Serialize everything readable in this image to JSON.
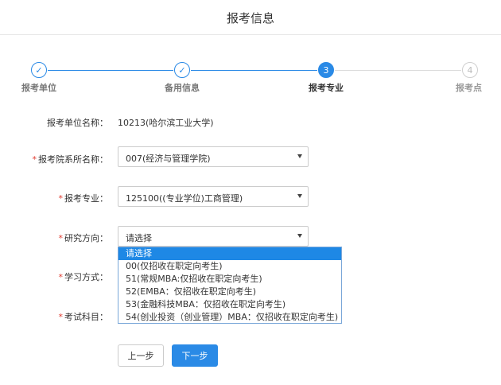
{
  "header": {
    "title": "报考信息"
  },
  "steps": [
    {
      "label": "报考单位",
      "state": "done",
      "glyph": "✓"
    },
    {
      "label": "备用信息",
      "state": "done",
      "glyph": "✓"
    },
    {
      "label": "报考专业",
      "state": "active",
      "glyph": "3"
    },
    {
      "label": "报考点",
      "state": "todo",
      "glyph": "4"
    }
  ],
  "form": {
    "unit_label": "报考单位名称：",
    "unit_value": "10213(哈尔滨工业大学)",
    "required_mark": "*",
    "department_label": "报考院系所名称：",
    "department_value": "007(经济与管理学院)",
    "major_label": "报考专业：",
    "major_value": "125100((专业学位)工商管理)",
    "direction_label": "研究方向：",
    "direction_value": "请选择",
    "study_mode_label": "学习方式：",
    "exam_subject_label": "考试科目："
  },
  "dropdown": {
    "options": [
      "请选择",
      "00(仅招收在职定向考生)",
      "51(常规MBA:仅招收在职定向考生)",
      "52(EMBA：仅招收在职定向考生)",
      "53(金融科技MBA：仅招收在职定向考生)",
      "54(创业投资（创业管理）MBA：仅招收在职定向考生)"
    ],
    "selected_index": 0
  },
  "buttons": {
    "prev_label": "上一步",
    "next_label": "下一步"
  },
  "colors": {
    "accent": "#2a8ae6",
    "required": "#e03a2f",
    "inactive": "#cfcfcf"
  }
}
